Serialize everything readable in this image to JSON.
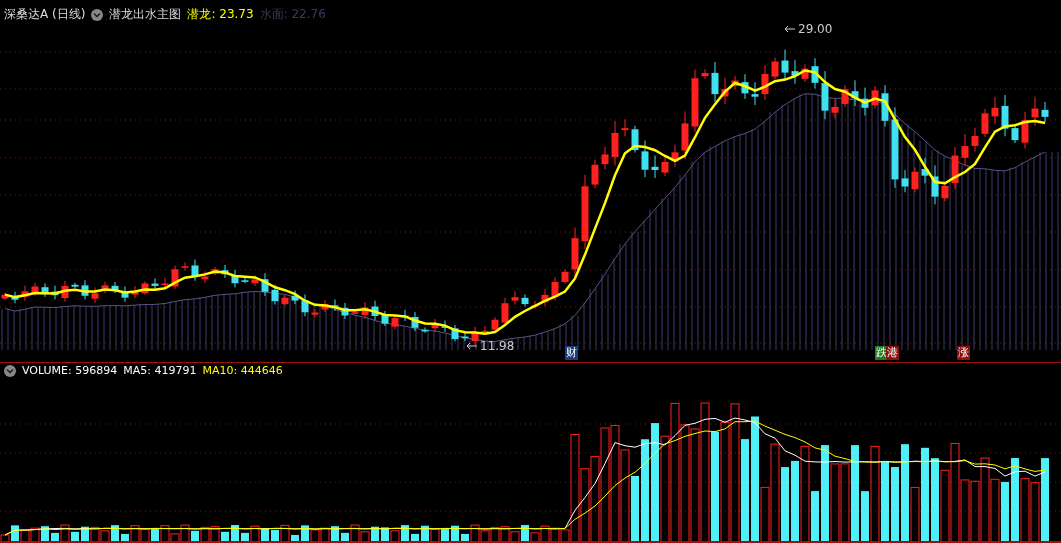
{
  "header": {
    "stock": "深桑达A (日线)",
    "indicator": "潜龙出水主图",
    "values": [
      {
        "label": "潜龙:",
        "value": "23.73",
        "color": "#ffff00"
      },
      {
        "label": "水面:",
        "value": "22.76",
        "color": "#3a3a58"
      }
    ]
  },
  "price_labels": [
    {
      "kind": "high",
      "text": "29.00"
    },
    {
      "kind": "low",
      "text": "11.98"
    }
  ],
  "markers": [
    {
      "text": "财",
      "color": "#1e3c78"
    },
    {
      "text": "跌",
      "color": "#1e7a1e"
    },
    {
      "text": "港",
      "color": "#8a1010"
    },
    {
      "text": "涨",
      "color": "#8a1010"
    }
  ],
  "volume": {
    "values": [
      {
        "label": "VOLUME:",
        "value": "596894",
        "color": "#ffffff"
      },
      {
        "label": "MA5:",
        "value": "419791",
        "color": "#ffffff"
      },
      {
        "label": "MA10:",
        "value": "444646",
        "color": "#ffff00"
      }
    ]
  }
}
